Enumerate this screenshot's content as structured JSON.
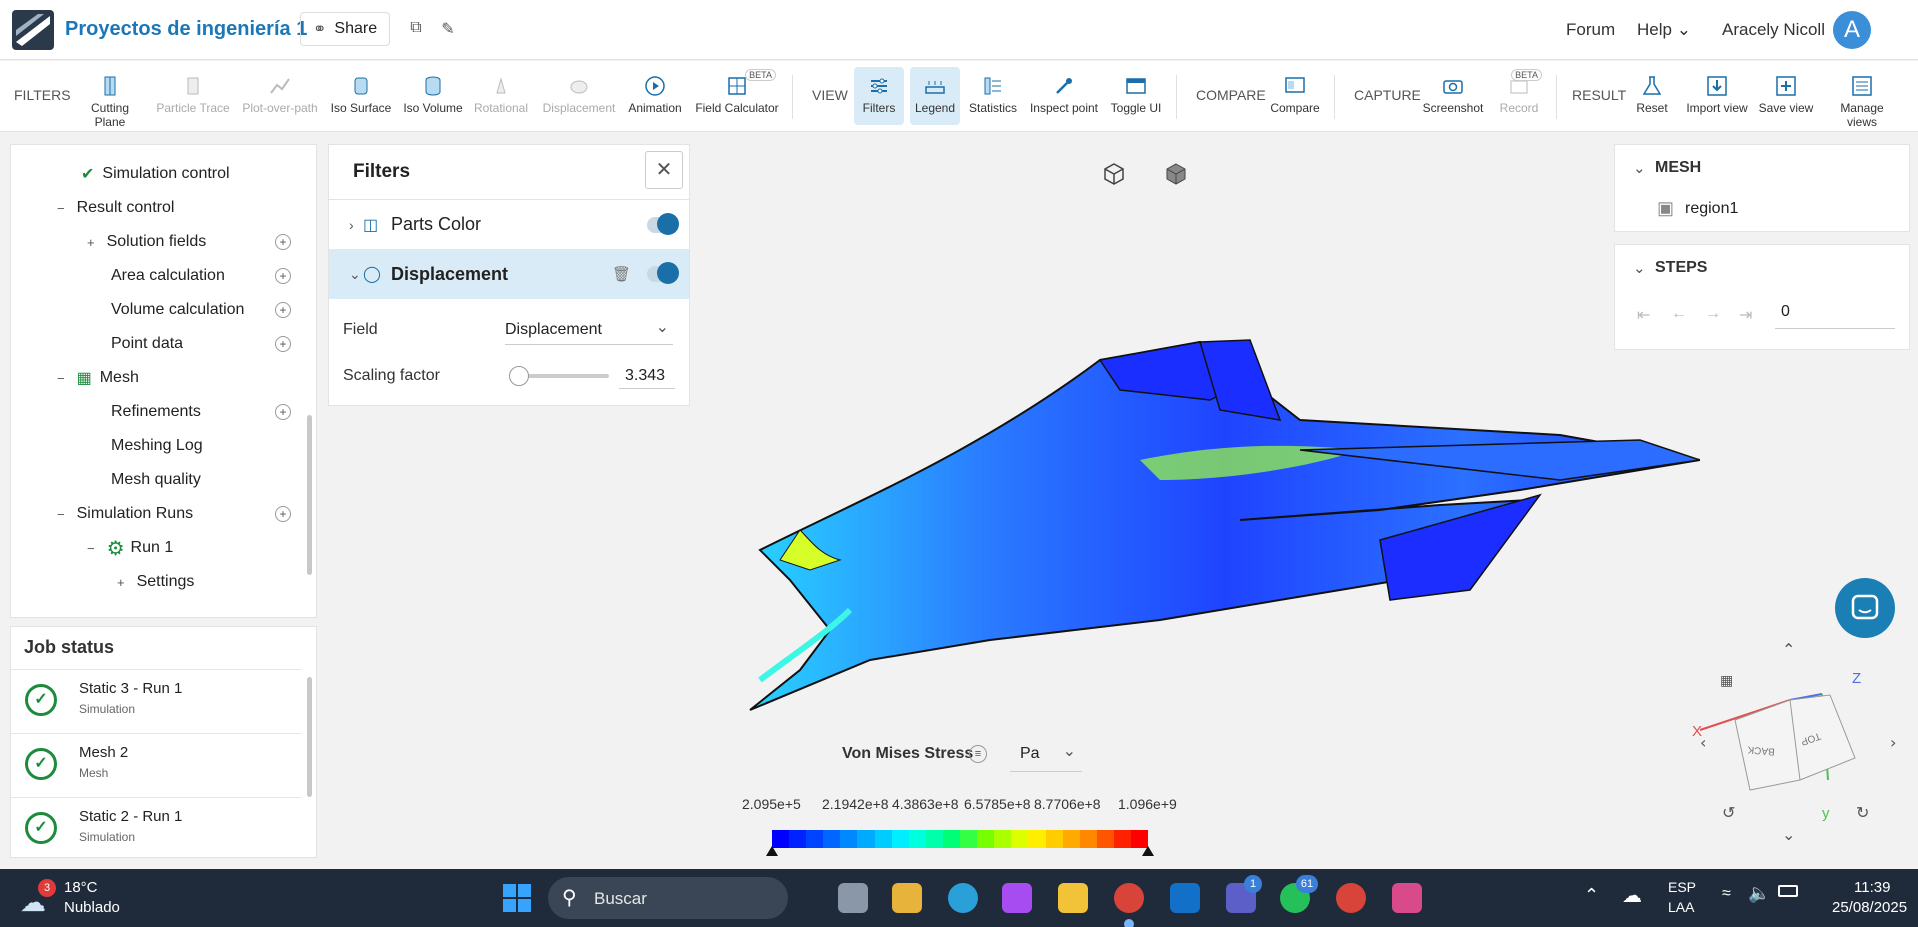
{
  "header": {
    "project_title": "Proyectos de ingeniería 1",
    "share_label": "Share",
    "forum": "Forum",
    "help": "Help",
    "user_name": "Aracely Nicoll",
    "avatar_letter": "A"
  },
  "toolbar": {
    "filters_section": "FILTERS",
    "view_section": "VIEW",
    "compare_section": "COMPARE",
    "capture_section": "CAPTURE",
    "result_section": "RESULT",
    "beta": "BETA",
    "buttons": {
      "cutting_plane": "Cutting Plane",
      "particle_trace": "Particle Trace",
      "plot_over_path": "Plot-over-path",
      "iso_surface": "Iso Surface",
      "iso_volume": "Iso Volume",
      "rotational": "Rotational",
      "displacement": "Displacement",
      "animation": "Animation",
      "field_calculator": "Field Calculator",
      "filters": "Filters",
      "legend": "Legend",
      "statistics": "Statistics",
      "inspect_point": "Inspect point",
      "toggle_ui": "Toggle UI",
      "compare": "Compare",
      "screenshot": "Screenshot",
      "record": "Record",
      "reset": "Reset",
      "import_view": "Import view",
      "save_view": "Save view",
      "manage_views": "Manage views"
    }
  },
  "tree": {
    "simulation_control": "Simulation control",
    "result_control": "Result control",
    "solution_fields": "Solution fields",
    "area_calculation": "Area calculation",
    "volume_calculation": "Volume calculation",
    "point_data": "Point data",
    "mesh": "Mesh",
    "refinements": "Refinements",
    "meshing_log": "Meshing Log",
    "mesh_quality": "Mesh quality",
    "simulation_runs": "Simulation Runs",
    "run1": "Run 1",
    "settings": "Settings"
  },
  "job_status": {
    "title": "Job status",
    "items": [
      {
        "name": "Static 3 - Run 1",
        "type": "Simulation"
      },
      {
        "name": "Mesh 2",
        "type": "Mesh"
      },
      {
        "name": "Static 2 - Run 1",
        "type": "Simulation"
      }
    ]
  },
  "filters_panel": {
    "title": "Filters",
    "parts_color": "Parts Color",
    "displacement": "Displacement",
    "field_label": "Field",
    "field_value": "Displacement",
    "scaling_label": "Scaling factor",
    "scaling_value": "3.343",
    "scaling_slider_fraction": 0.05
  },
  "right_panel": {
    "mesh_title": "MESH",
    "region": "region1",
    "steps_title": "STEPS",
    "step_value": "0"
  },
  "legend": {
    "title": "Von Mises Stress",
    "unit": "Pa",
    "ticks": [
      "2.095e+5",
      "2.1942e+8",
      "4.3863e+8",
      "6.5785e+8",
      "8.7706e+8",
      "1.096e+9"
    ],
    "colors": [
      "#0000ff",
      "#0022ff",
      "#0044ff",
      "#0066ff",
      "#0088ff",
      "#00aaff",
      "#00ccff",
      "#00eeff",
      "#00ffdd",
      "#00ffaa",
      "#00ff77",
      "#33ff44",
      "#77ff00",
      "#aaff00",
      "#ddff00",
      "#ffee00",
      "#ffcc00",
      "#ffaa00",
      "#ff8800",
      "#ff5500",
      "#ff2200",
      "#ff0000"
    ]
  },
  "axes": {
    "x": "X",
    "y": "y",
    "z": "Z",
    "top": "TOP",
    "back": "BACK"
  },
  "taskbar": {
    "weather_badge": "3",
    "temperature": "18°C",
    "condition": "Nublado",
    "search": "Buscar",
    "teams_badge": "1",
    "whatsapp_badge": "61",
    "lang_top": "ESP",
    "lang_bottom": "LAA",
    "time": "11:39",
    "date": "25/08/2025"
  }
}
